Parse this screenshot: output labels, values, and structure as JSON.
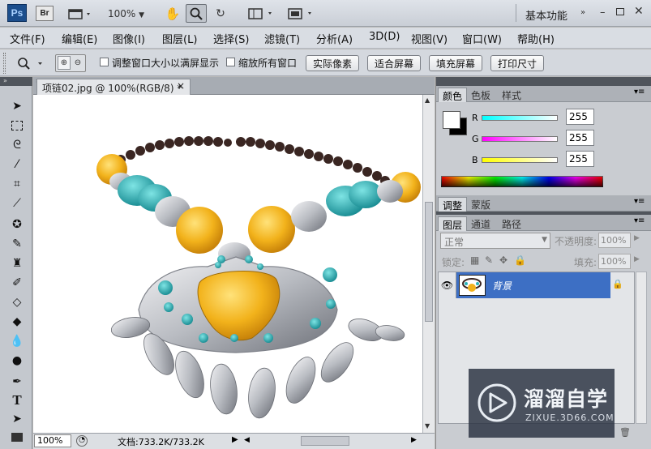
{
  "app": {
    "ps_logo": "Ps",
    "br_logo": "Br",
    "zoom": "100%",
    "workspace": "基本功能"
  },
  "menu": [
    "文件(F)",
    "编辑(E)",
    "图像(I)",
    "图层(L)",
    "选择(S)",
    "滤镜(T)",
    "分析(A)",
    "3D(D)",
    "视图(V)",
    "窗口(W)",
    "帮助(H)"
  ],
  "options": {
    "resize_windows": "调整窗口大小以满屏显示",
    "zoom_all": "缩放所有窗口",
    "actual_pixels": "实际像素",
    "fit_screen": "适合屏幕",
    "fill_screen": "填充屏幕",
    "print_size": "打印尺寸"
  },
  "document": {
    "tab_label": "项链02.jpg @ 100%(RGB/8) *",
    "close": "×"
  },
  "status": {
    "zoom": "100%",
    "doc_info": "文档:733.2K/733.2K"
  },
  "color_panel": {
    "tabs": [
      "颜色",
      "色板",
      "样式"
    ],
    "r_label": "R",
    "g_label": "G",
    "b_label": "B",
    "r": "255",
    "g": "255",
    "b": "255"
  },
  "adjust_panel": {
    "tabs": [
      "调整",
      "蒙版"
    ]
  },
  "layers_panel": {
    "tabs": [
      "图层",
      "通道",
      "路径"
    ],
    "blend_mode": "正常",
    "opacity_label": "不透明度:",
    "opacity": "100%",
    "lock_label": "锁定:",
    "fill_label": "填充:",
    "fill": "100%",
    "layer_name": "背景"
  },
  "watermark": {
    "title": "溜溜自学",
    "url": "ZIXUE.3D66.COM"
  },
  "colors": {
    "accent": "#3d6fc4",
    "titlebar": "#d2d6dc",
    "necklace_amber": "#f2b21b",
    "turquoise": "#2ab3b8"
  }
}
